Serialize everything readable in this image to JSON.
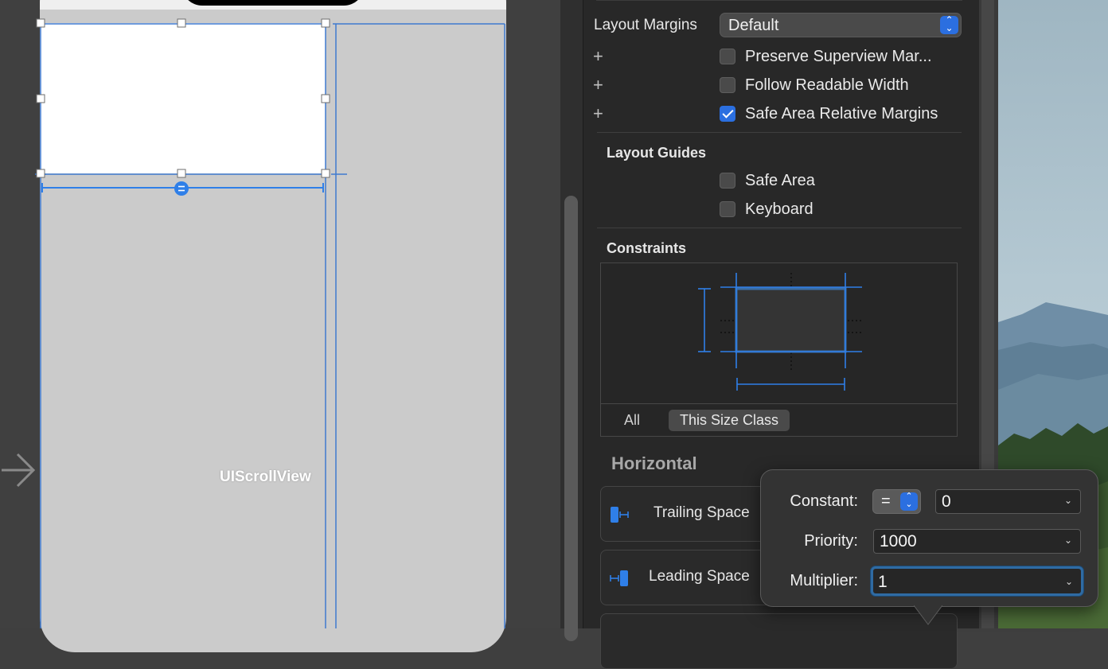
{
  "canvas": {
    "scroll_view_label": "UIScrollView"
  },
  "inspector": {
    "layout_margins": {
      "label": "Layout Margins",
      "value": "Default"
    },
    "checkboxes": [
      {
        "label": "Preserve Superview Mar...",
        "checked": false
      },
      {
        "label": "Follow Readable Width",
        "checked": false
      },
      {
        "label": "Safe Area Relative Margins",
        "checked": true
      }
    ],
    "layout_guides": {
      "title": "Layout Guides",
      "items": [
        {
          "label": "Safe Area",
          "checked": false
        },
        {
          "label": "Keyboard",
          "checked": false
        }
      ]
    },
    "constraints": {
      "title": "Constraints",
      "segments": [
        "All",
        "This Size Class"
      ],
      "selected_segment": "This Size Class"
    },
    "horizontal": {
      "title": "Horizontal",
      "rows": [
        {
          "label": "Trailing Space",
          "icon": "trailing-space-icon"
        },
        {
          "label": "Leading Space",
          "icon": "leading-space-icon"
        }
      ]
    }
  },
  "popover": {
    "constant": {
      "label": "Constant:",
      "relation": "=",
      "value": "0"
    },
    "priority": {
      "label": "Priority:",
      "value": "1000"
    },
    "multiplier": {
      "label": "Multiplier:",
      "value": "1"
    }
  },
  "colors": {
    "accent": "#2b6fe0",
    "guide_blue": "#2f7fe8",
    "inspector_bg": "#282828",
    "canvas_bg": "#404040",
    "view_gray": "#cbcbcb"
  }
}
